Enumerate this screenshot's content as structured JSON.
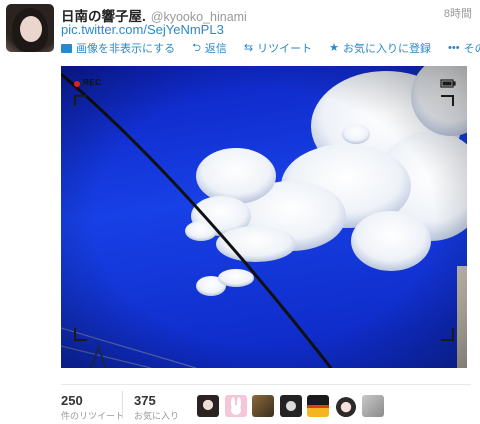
{
  "tweet": {
    "author_name": "日南の響子屋.",
    "author_handle": "@kyooko_hinami",
    "timestamp": "8時間",
    "link_text": "pic.twitter.com/SejYeNmPL3"
  },
  "actions": {
    "hide_image": "画像を非表示にする",
    "reply": "返信",
    "retweet": "リツイート",
    "favorite": "お気に入りに登録",
    "more": "その他"
  },
  "photo": {
    "rec_label": "REC"
  },
  "stats": {
    "retweets": {
      "count": "250",
      "label": "件のリツイート"
    },
    "favorites": {
      "count": "375",
      "label": "お気に入り"
    }
  },
  "colors": {
    "link": "#2a88c8",
    "sky": "#1030d8"
  }
}
